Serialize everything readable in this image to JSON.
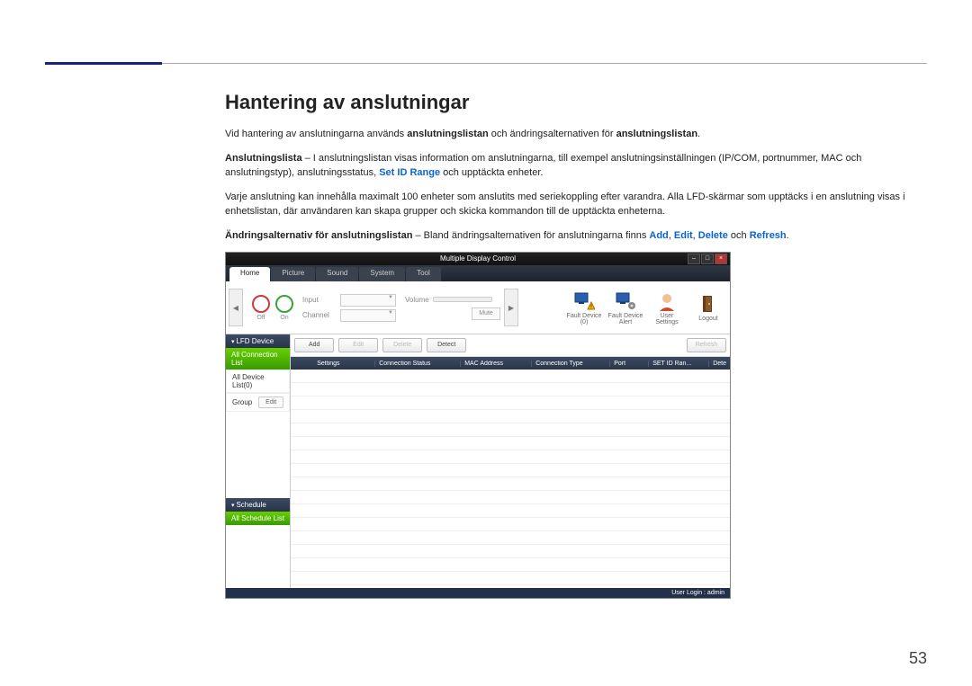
{
  "heading": "Hantering av anslutningar",
  "para1": {
    "t1": "Vid hantering av anslutningarna används ",
    "b1": "anslutningslistan",
    "t2": " och ändringsalternativen för ",
    "b2": "anslutningslistan",
    "t3": "."
  },
  "para2": {
    "b1": "Anslutningslista",
    "t1": " – I anslutningslistan visas information om anslutningarna, till exempel anslutningsinställningen (IP/COM, portnummer, MAC och anslutningstyp), anslutningsstatus, ",
    "h1": "Set ID Range",
    "t2": " och upptäckta enheter."
  },
  "para3": "Varje anslutning kan innehålla maximalt 100 enheter som anslutits med seriekoppling efter varandra. Alla LFD-skärmar som upptäcks i en anslutning visas i enhetslistan, där användaren kan skapa grupper och skicka kommandon till de upptäckta enheterna.",
  "para4": {
    "b1": "Ändringsalternativ för anslutningslistan",
    "t1": " – Bland ändringsalternativen för anslutningarna finns ",
    "h1": "Add",
    "c1": ", ",
    "h2": "Edit",
    "c2": ", ",
    "h3": "Delete",
    "t2": " och ",
    "h4": "Refresh",
    "t3": "."
  },
  "app": {
    "title": "Multiple Display Control",
    "tabs": [
      "Home",
      "Picture",
      "Sound",
      "System",
      "Tool"
    ],
    "power": {
      "on": "On",
      "off": "Off"
    },
    "input_label": "Input",
    "channel_label": "Channel",
    "volume_label": "Volume",
    "mute": "Mute",
    "actions": {
      "fault": "Fault Device (0)",
      "alert": "Fault Device Alert",
      "user": "User Settings",
      "logout": "Logout"
    },
    "crud": {
      "add": "Add",
      "edit": "Edit",
      "delete": "Delete",
      "detect": "Detect",
      "refresh": "Refresh"
    },
    "sidebar": {
      "lfd": "LFD Device",
      "all_conn": "All Connection List",
      "all_dev": "All Device List(0)",
      "group": "Group",
      "edit": "Edit",
      "schedule": "Schedule",
      "all_sched": "All Schedule List"
    },
    "grid": {
      "cols": [
        "",
        "Settings",
        "Connection Status",
        "MAC Address",
        "Connection Type",
        "Port",
        "SET ID Ran...",
        "Dete"
      ]
    },
    "status": "User Login : admin"
  },
  "pagenum": "53"
}
